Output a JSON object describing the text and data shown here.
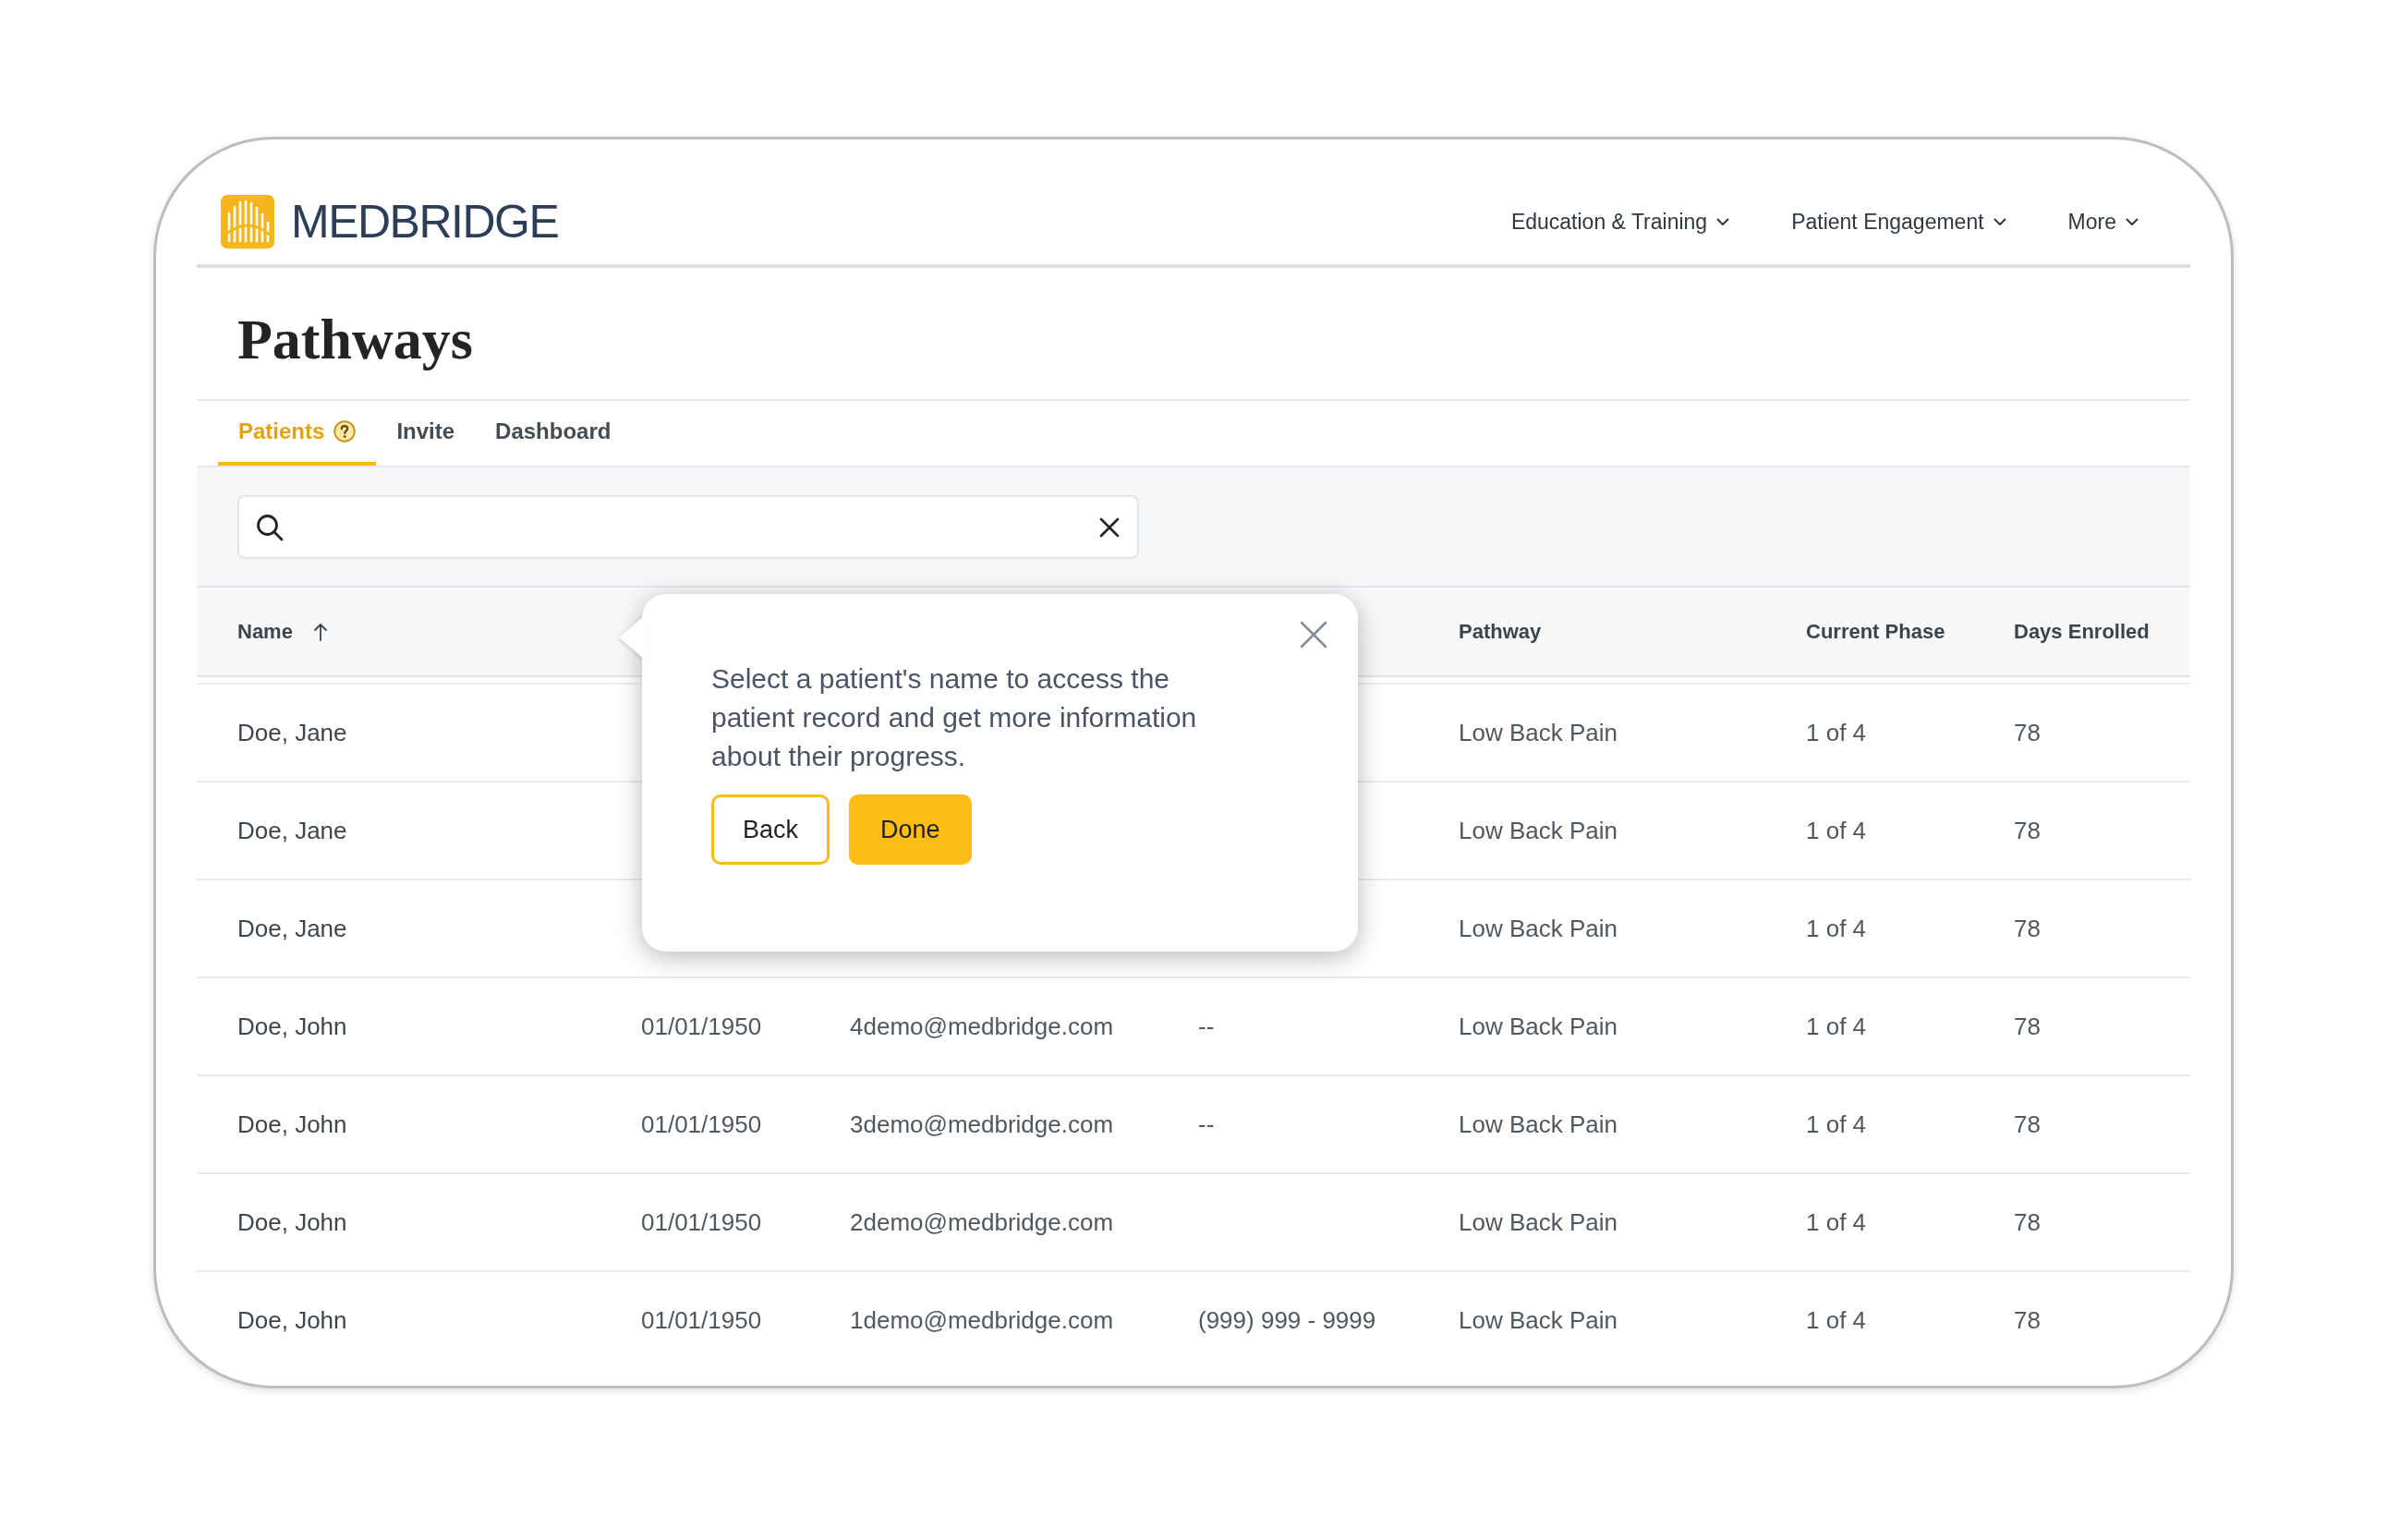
{
  "brand": {
    "name": "MEDBRIDGE"
  },
  "nav": [
    {
      "label": "Education & Training",
      "dropdown": true
    },
    {
      "label": "Patient Engagement",
      "dropdown": true
    },
    {
      "label": "More",
      "dropdown": true
    }
  ],
  "page_title": "Pathways",
  "tabs": [
    {
      "label": "Patients",
      "selected": true,
      "help": true
    },
    {
      "label": "Invite",
      "selected": false,
      "help": false
    },
    {
      "label": "Dashboard",
      "selected": false,
      "help": false
    }
  ],
  "search": {
    "clear_button": true
  },
  "table": {
    "columns": {
      "name": {
        "label": "Name",
        "sort_ascending": true
      },
      "pathway": {
        "label": "Pathway"
      },
      "current_phase": {
        "label": "Current Phase"
      },
      "days_enrolled": {
        "label": "Days Enrolled"
      }
    },
    "rows": [
      {
        "name": "Doe, Jane",
        "pathway": "Low Back Pain",
        "current_phase": "1 of 4",
        "days_enrolled": "78"
      },
      {
        "name": "Doe, Jane",
        "pathway": "Low Back Pain",
        "current_phase": "1 of 4",
        "days_enrolled": "78"
      },
      {
        "name": "Doe, Jane",
        "pathway": "Low Back Pain",
        "current_phase": "1 of 4",
        "days_enrolled": "78"
      },
      {
        "name": "Doe, John",
        "column_2": "01/01/1950",
        "column_3": "4demo@medbridge.com",
        "column_4": "--",
        "pathway": "Low Back Pain",
        "current_phase": "1 of 4",
        "days_enrolled": "78"
      },
      {
        "name": "Doe, John",
        "column_2": "01/01/1950",
        "column_3": "3demo@medbridge.com",
        "column_4": "--",
        "pathway": "Low Back Pain",
        "current_phase": "1 of 4",
        "days_enrolled": "78"
      },
      {
        "name": "Doe, John",
        "column_2": "01/01/1950",
        "column_3": "2demo@medbridge.com",
        "pathway": "Low Back Pain",
        "current_phase": "1 of 4",
        "days_enrolled": "78"
      },
      {
        "name": "Doe, John",
        "column_2": "01/01/1950",
        "column_3": "1demo@medbridge.com",
        "column_4": "(999) 999 - 9999",
        "pathway": "Low Back Pain",
        "current_phase": "1 of 4",
        "days_enrolled": "78"
      }
    ]
  },
  "tooltip": {
    "closable": true,
    "text": "Select a patient's name to access the patient record and get more information about their progress.",
    "buttons": [
      {
        "label": "Back",
        "kind": "secondary"
      },
      {
        "label": "Done",
        "kind": "primary"
      }
    ]
  }
}
